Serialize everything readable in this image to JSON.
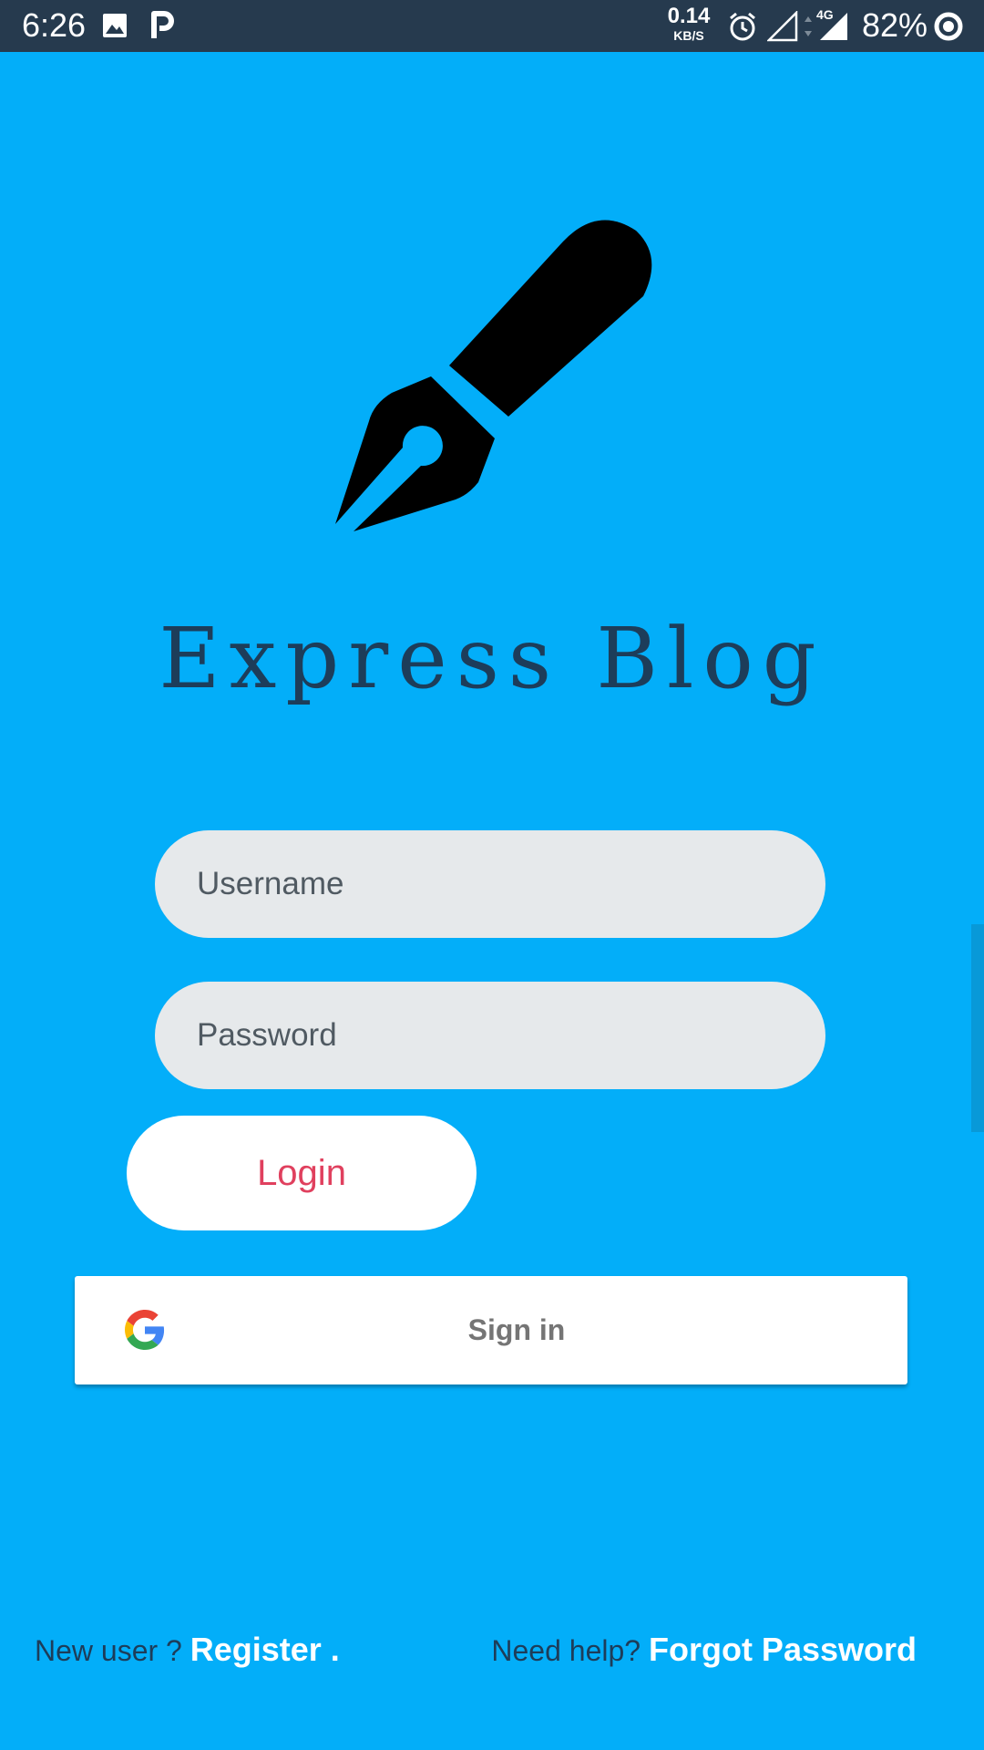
{
  "status_bar": {
    "time": "6:26",
    "net_speed": "0.14",
    "net_speed_unit": "KB/S",
    "network_type": "4G",
    "battery": "82%",
    "icons": [
      "image-icon",
      "p-app-icon",
      "alarm-icon",
      "signal-empty-icon",
      "data-arrows-icon",
      "signal-full-icon",
      "battery-ring-icon"
    ]
  },
  "app": {
    "title": "Express Blog",
    "logo_icon": "fountain-pen-icon"
  },
  "form": {
    "username_placeholder": "Username",
    "password_placeholder": "Password",
    "login_label": "Login"
  },
  "google_signin": {
    "icon": "google-g-icon",
    "label": "Sign in"
  },
  "footer": {
    "new_user_text": "New user ?",
    "register_label": "Register .",
    "need_help_text": "Need help?",
    "forgot_label": "Forgot Password"
  },
  "colors": {
    "background": "#03aef9",
    "status_bar": "#263a4e",
    "input_fill": "#e6e9eb",
    "login_text": "#e0405e",
    "title_text": "#1d3d5a",
    "link_text": "#ffffff"
  }
}
